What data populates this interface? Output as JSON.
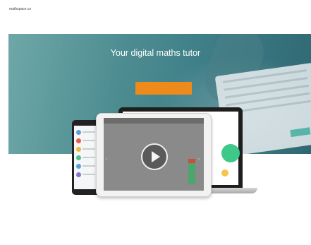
{
  "browser": {
    "url": "mathspace.co"
  },
  "nav": {
    "logo": "",
    "links": [
      "",
      ""
    ]
  },
  "hero": {
    "title": "Your digital maths tutor",
    "subtitle": "",
    "cta_label": ""
  },
  "devices": {
    "tablet_header": "",
    "laptop_badge": ""
  },
  "features": [
    {
      "title": "",
      "body": ""
    },
    {
      "title": "",
      "body": ""
    },
    {
      "title": "",
      "body": ""
    }
  ],
  "colors": {
    "hero": "#4e8e92",
    "cta": "#ec8a1c",
    "accent_green": "#3ec98a"
  }
}
